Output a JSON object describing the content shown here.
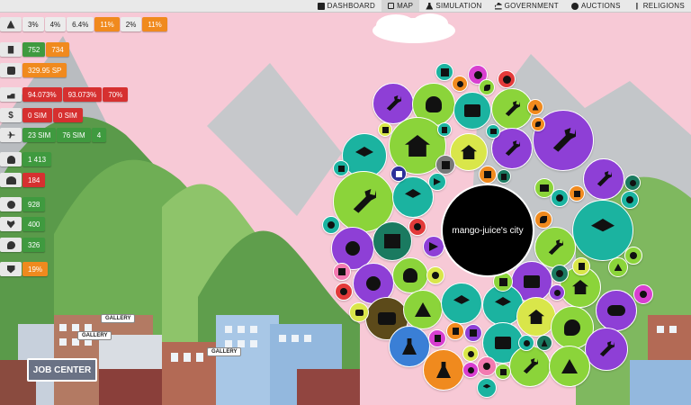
{
  "nav": {
    "items": [
      {
        "label": "DASHBOARD",
        "icon": "monitor-icon",
        "active": false
      },
      {
        "label": "MAP",
        "icon": "map-icon",
        "active": true
      },
      {
        "label": "SIMULATION",
        "icon": "flask-icon",
        "active": false
      },
      {
        "label": "GOVERNMENT",
        "icon": "government-icon",
        "active": false
      },
      {
        "label": "AUCTIONS",
        "icon": "auction-icon",
        "active": false
      },
      {
        "label": "RELIGIONS",
        "icon": "religion-icon",
        "active": false
      }
    ]
  },
  "stats": {
    "alerts": {
      "icon": "warning-icon",
      "values": [
        "3%",
        "4%",
        "6.4%",
        "11%",
        "2%",
        "11%"
      ]
    },
    "buildings": {
      "icon": "building-icon",
      "values": [
        "752",
        "734"
      ]
    },
    "money": {
      "icon": "coins-icon",
      "value": "329.95 SP"
    },
    "employment": {
      "icon": "hand-icon",
      "values": [
        "94.073%",
        "93.073%",
        "70%"
      ]
    },
    "income": {
      "icon": "dollar-icon",
      "values": [
        "0 SIM",
        "0 SIM"
      ]
    },
    "travel": {
      "icon": "plane-icon",
      "values": [
        "23 SIM",
        "76 SIM",
        "4"
      ]
    },
    "population": {
      "icon": "user-icon",
      "value": "1 413"
    },
    "homeless": {
      "icon": "users-icon",
      "value": "184"
    },
    "happiness": {
      "icon": "smile-icon",
      "value": "928"
    },
    "health": {
      "icon": "heart-icon",
      "value": "400"
    },
    "culture": {
      "icon": "palette-icon",
      "value": "326"
    },
    "security": {
      "icon": "shield-icon",
      "value": "19%"
    }
  },
  "city": {
    "name": "mango-juice's city",
    "signs": {
      "job_center": "JOB CENTER",
      "gallery": "GALLERY"
    }
  },
  "colors": {
    "sky": "#f7c9d6",
    "mountain_dark": "#5a9a4a",
    "mountain_light": "#8ec46a",
    "accent_orange": "#f08a1e",
    "accent_green": "#3f9a3f",
    "accent_red": "#d63030"
  }
}
